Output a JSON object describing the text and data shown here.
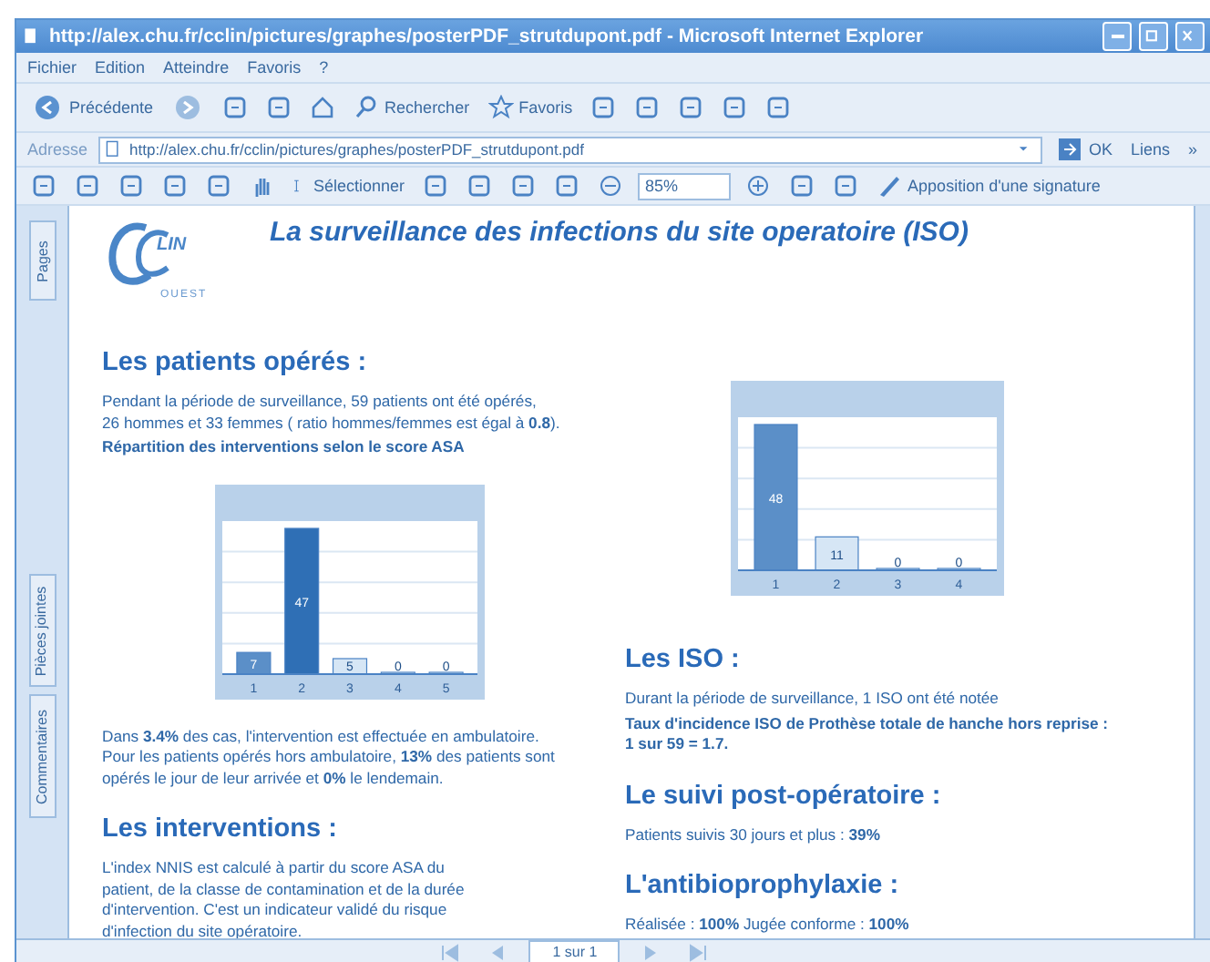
{
  "window": {
    "title": "http://alex.chu.fr/cclin/pictures/graphes/posterPDF_strutdupont.pdf - Microsoft Internet Explorer"
  },
  "menu": [
    "Fichier",
    "Edition",
    "Atteindre",
    "Favoris",
    "?"
  ],
  "toolbar": {
    "back": "Précédente",
    "search": "Rechercher",
    "favorites": "Favoris"
  },
  "address_bar": {
    "label": "Adresse",
    "value": "http://alex.chu.fr/cclin/pictures/graphes/posterPDF_strutdupont.pdf",
    "go": "OK",
    "links": "Liens",
    "more": "»"
  },
  "reader_toolbar": {
    "select": "Sélectionner",
    "zoom": "85%",
    "signature": "Apposition d'une signature"
  },
  "side_tabs": [
    "Pages",
    "Pièces jointes",
    "Commentaires"
  ],
  "document": {
    "logo": {
      "text": "LIN",
      "subtext": "OUEST"
    },
    "title": "La surveillance des infections du site operatoire (ISO)",
    "left_column": [
      {
        "kind": "heading",
        "text": "Les patients opérés :"
      },
      {
        "kind": "text",
        "lines": [
          "Pendant la période de surveillance, 59 patients ont été opérés,",
          " 26 hommes et 33 femmes ( ratio hommes/femmes  est égal à **0.8**)."
        ]
      },
      {
        "kind": "bold_text",
        "lines": [
          "Répartition des interventions selon le score ASA"
        ]
      },
      {
        "kind": "chart",
        "chart_data": {
          "type": "bar",
          "categories": [
            "1",
            "2",
            "3",
            "4",
            "5"
          ],
          "series": [
            {
              "values": [
                7,
                47,
                5,
                0,
                0
              ]
            }
          ],
          "data_labels": true
        }
      },
      {
        "kind": "text",
        "lines": [
          "Dans **3.4%** des cas, l'intervention est effectuée en ambulatoire.",
          " Pour les patients opérés hors ambulatoire, **13%** des patients sont",
          "opérés le jour de leur arrivée et  **0%** le lendemain."
        ]
      },
      {
        "kind": "heading",
        "text": "Les interventions :"
      },
      {
        "kind": "text",
        "lines": [
          "L'index NNIS est calculé à partir du score ASA du",
          "patient, de la classe de contamination et de la durée",
          "d'intervention. C'est un indicateur validé du risque",
          " d'infection du site opératoire."
        ]
      }
    ],
    "right_column": [
      {
        "kind": "chart",
        "chart_data": {
          "type": "bar",
          "categories": [
            "1",
            "2",
            "3",
            "4"
          ],
          "series": [
            {
              "values": [
                48,
                11,
                0,
                0
              ]
            }
          ],
          "data_labels": true
        }
      },
      {
        "kind": "heading",
        "text": "Les ISO :"
      },
      {
        "kind": "text",
        "lines": [
          "  Durant la période de surveillance, 1 ISO ont été notée"
        ]
      },
      {
        "kind": "bold_text",
        "lines": [
          "Taux d'incidence ISO de Prothèse totale de hanche hors reprise :",
          "1 sur 59 = 1.7."
        ]
      },
      {
        "kind": "heading",
        "text": "Le suivi post-opératoire :"
      },
      {
        "kind": "text",
        "lines": [
          "Patients suivis 30 jours et plus : **39%**"
        ]
      },
      {
        "kind": "heading",
        "text": "L'antibioprophylaxie :"
      },
      {
        "kind": "text",
        "lines": [
          "Réalisée : **100%**   Jugée conforme : **100%**"
        ]
      }
    ]
  },
  "status_bar": {
    "page": "1 sur 1"
  }
}
